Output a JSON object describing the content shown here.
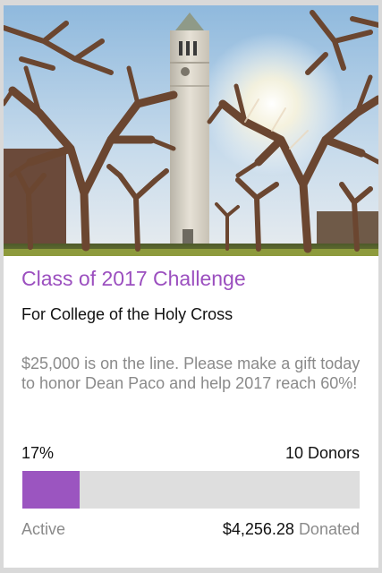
{
  "campaign": {
    "title": "Class of 2017 Challenge",
    "subtitle": "For College of the Holy Cross",
    "description": "$25,000 is on the line. Please make a gift today to honor Dean Paco and help 2017 reach 60%!"
  },
  "progress": {
    "percent_label": "17%",
    "fraction": 0.17,
    "donors_label": "10 Donors",
    "status": "Active",
    "amount": "$4,256.28",
    "amount_suffix": "Donated"
  },
  "colors": {
    "accent": "#9b55c0",
    "title": "#9b4fbf",
    "track": "#dedede",
    "muted_text": "#8a8a8a"
  }
}
